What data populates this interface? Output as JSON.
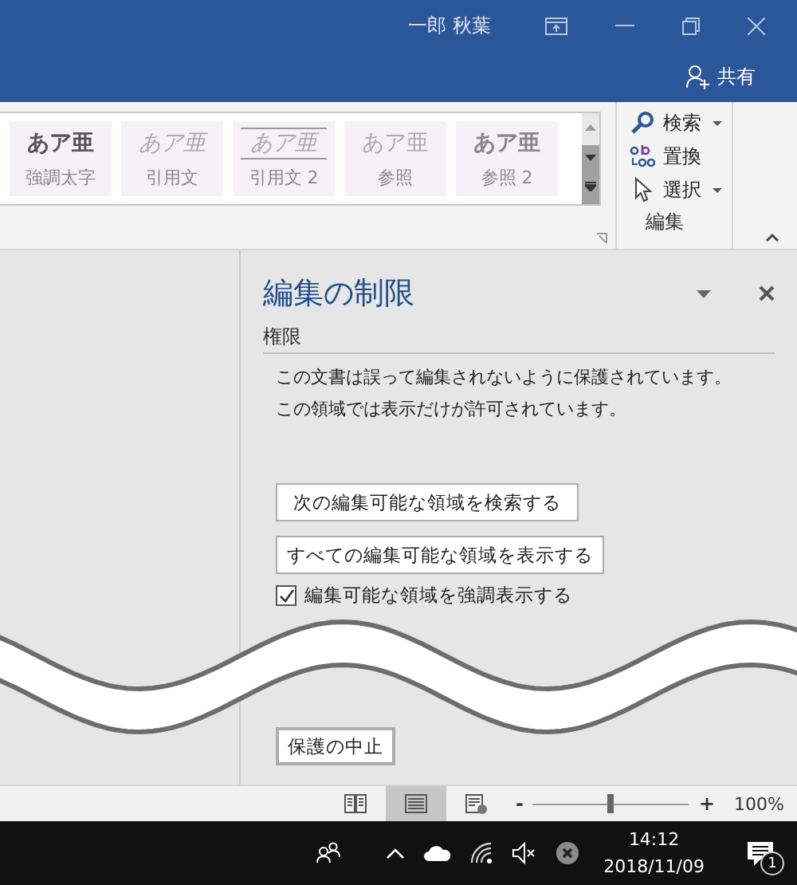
{
  "window": {
    "user": "一郎 秋葉",
    "share_button": "共有"
  },
  "styles_gallery": [
    {
      "sample": "あア亜",
      "label": "強調太字",
      "kind": "bold"
    },
    {
      "sample": "あア亜",
      "label": "引用文",
      "kind": "italic"
    },
    {
      "sample": "あア亜",
      "label": "引用文 2",
      "kind": "lined"
    },
    {
      "sample": "あア亜",
      "label": "参照",
      "kind": "plain"
    },
    {
      "sample": "あア亜",
      "label": "参照 2",
      "kind": "strong"
    }
  ],
  "editing_group": {
    "label": "編集",
    "commands": [
      {
        "label": "検索",
        "dropdown": true,
        "kind": "search"
      },
      {
        "label": "置換",
        "dropdown": false,
        "kind": "replace"
      },
      {
        "label": "選択",
        "dropdown": true,
        "kind": "select"
      }
    ]
  },
  "pane": {
    "title": "編集の制限",
    "section": "権限",
    "messages": [
      "この文書は誤って編集されないように保護されています。",
      "この領域では表示だけが許可されています。"
    ],
    "buttons": [
      "次の編集可能な領域を検索する",
      "すべての編集可能な領域を表示する"
    ],
    "highlight_checkbox": {
      "label": "編集可能な領域を強調表示する",
      "checked": true
    },
    "stop_button": "保護の中止"
  },
  "status_bar": {
    "views": [
      {
        "kind": "read",
        "selected": false
      },
      {
        "kind": "print",
        "selected": true
      },
      {
        "kind": "web",
        "selected": false
      }
    ],
    "zoom": {
      "minus": "-",
      "plus": "+",
      "level": 0.5,
      "reading": "100%"
    }
  },
  "taskbar": {
    "time": "14:12",
    "date": "2018/11/09",
    "notifications": "1"
  }
}
